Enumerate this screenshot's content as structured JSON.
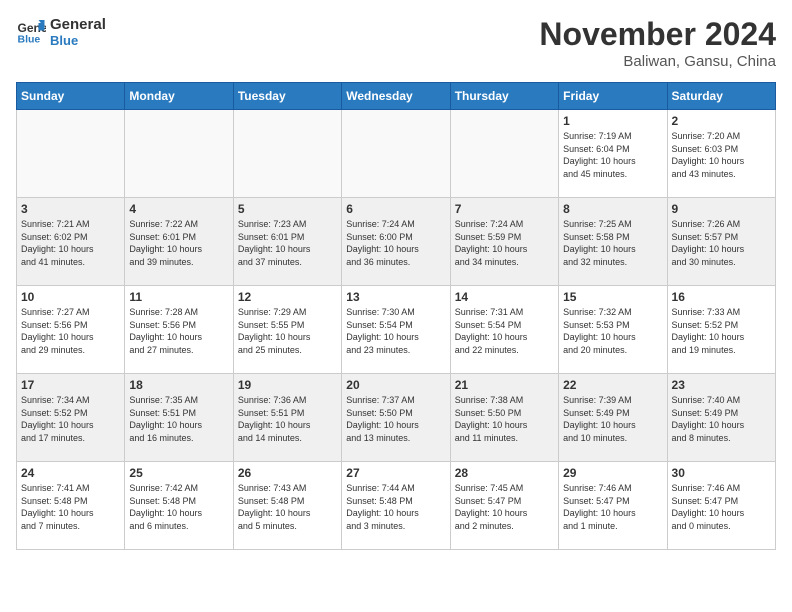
{
  "header": {
    "logo_line1": "General",
    "logo_line2": "Blue",
    "month_title": "November 2024",
    "location": "Baliwan, Gansu, China"
  },
  "days_of_week": [
    "Sunday",
    "Monday",
    "Tuesday",
    "Wednesday",
    "Thursday",
    "Friday",
    "Saturday"
  ],
  "weeks": [
    {
      "row_alt": false,
      "days": [
        {
          "num": "",
          "info": ""
        },
        {
          "num": "",
          "info": ""
        },
        {
          "num": "",
          "info": ""
        },
        {
          "num": "",
          "info": ""
        },
        {
          "num": "",
          "info": ""
        },
        {
          "num": "1",
          "info": "Sunrise: 7:19 AM\nSunset: 6:04 PM\nDaylight: 10 hours\nand 45 minutes."
        },
        {
          "num": "2",
          "info": "Sunrise: 7:20 AM\nSunset: 6:03 PM\nDaylight: 10 hours\nand 43 minutes."
        }
      ]
    },
    {
      "row_alt": true,
      "days": [
        {
          "num": "3",
          "info": "Sunrise: 7:21 AM\nSunset: 6:02 PM\nDaylight: 10 hours\nand 41 minutes."
        },
        {
          "num": "4",
          "info": "Sunrise: 7:22 AM\nSunset: 6:01 PM\nDaylight: 10 hours\nand 39 minutes."
        },
        {
          "num": "5",
          "info": "Sunrise: 7:23 AM\nSunset: 6:01 PM\nDaylight: 10 hours\nand 37 minutes."
        },
        {
          "num": "6",
          "info": "Sunrise: 7:24 AM\nSunset: 6:00 PM\nDaylight: 10 hours\nand 36 minutes."
        },
        {
          "num": "7",
          "info": "Sunrise: 7:24 AM\nSunset: 5:59 PM\nDaylight: 10 hours\nand 34 minutes."
        },
        {
          "num": "8",
          "info": "Sunrise: 7:25 AM\nSunset: 5:58 PM\nDaylight: 10 hours\nand 32 minutes."
        },
        {
          "num": "9",
          "info": "Sunrise: 7:26 AM\nSunset: 5:57 PM\nDaylight: 10 hours\nand 30 minutes."
        }
      ]
    },
    {
      "row_alt": false,
      "days": [
        {
          "num": "10",
          "info": "Sunrise: 7:27 AM\nSunset: 5:56 PM\nDaylight: 10 hours\nand 29 minutes."
        },
        {
          "num": "11",
          "info": "Sunrise: 7:28 AM\nSunset: 5:56 PM\nDaylight: 10 hours\nand 27 minutes."
        },
        {
          "num": "12",
          "info": "Sunrise: 7:29 AM\nSunset: 5:55 PM\nDaylight: 10 hours\nand 25 minutes."
        },
        {
          "num": "13",
          "info": "Sunrise: 7:30 AM\nSunset: 5:54 PM\nDaylight: 10 hours\nand 23 minutes."
        },
        {
          "num": "14",
          "info": "Sunrise: 7:31 AM\nSunset: 5:54 PM\nDaylight: 10 hours\nand 22 minutes."
        },
        {
          "num": "15",
          "info": "Sunrise: 7:32 AM\nSunset: 5:53 PM\nDaylight: 10 hours\nand 20 minutes."
        },
        {
          "num": "16",
          "info": "Sunrise: 7:33 AM\nSunset: 5:52 PM\nDaylight: 10 hours\nand 19 minutes."
        }
      ]
    },
    {
      "row_alt": true,
      "days": [
        {
          "num": "17",
          "info": "Sunrise: 7:34 AM\nSunset: 5:52 PM\nDaylight: 10 hours\nand 17 minutes."
        },
        {
          "num": "18",
          "info": "Sunrise: 7:35 AM\nSunset: 5:51 PM\nDaylight: 10 hours\nand 16 minutes."
        },
        {
          "num": "19",
          "info": "Sunrise: 7:36 AM\nSunset: 5:51 PM\nDaylight: 10 hours\nand 14 minutes."
        },
        {
          "num": "20",
          "info": "Sunrise: 7:37 AM\nSunset: 5:50 PM\nDaylight: 10 hours\nand 13 minutes."
        },
        {
          "num": "21",
          "info": "Sunrise: 7:38 AM\nSunset: 5:50 PM\nDaylight: 10 hours\nand 11 minutes."
        },
        {
          "num": "22",
          "info": "Sunrise: 7:39 AM\nSunset: 5:49 PM\nDaylight: 10 hours\nand 10 minutes."
        },
        {
          "num": "23",
          "info": "Sunrise: 7:40 AM\nSunset: 5:49 PM\nDaylight: 10 hours\nand 8 minutes."
        }
      ]
    },
    {
      "row_alt": false,
      "days": [
        {
          "num": "24",
          "info": "Sunrise: 7:41 AM\nSunset: 5:48 PM\nDaylight: 10 hours\nand 7 minutes."
        },
        {
          "num": "25",
          "info": "Sunrise: 7:42 AM\nSunset: 5:48 PM\nDaylight: 10 hours\nand 6 minutes."
        },
        {
          "num": "26",
          "info": "Sunrise: 7:43 AM\nSunset: 5:48 PM\nDaylight: 10 hours\nand 5 minutes."
        },
        {
          "num": "27",
          "info": "Sunrise: 7:44 AM\nSunset: 5:48 PM\nDaylight: 10 hours\nand 3 minutes."
        },
        {
          "num": "28",
          "info": "Sunrise: 7:45 AM\nSunset: 5:47 PM\nDaylight: 10 hours\nand 2 minutes."
        },
        {
          "num": "29",
          "info": "Sunrise: 7:46 AM\nSunset: 5:47 PM\nDaylight: 10 hours\nand 1 minute."
        },
        {
          "num": "30",
          "info": "Sunrise: 7:46 AM\nSunset: 5:47 PM\nDaylight: 10 hours\nand 0 minutes."
        }
      ]
    }
  ]
}
